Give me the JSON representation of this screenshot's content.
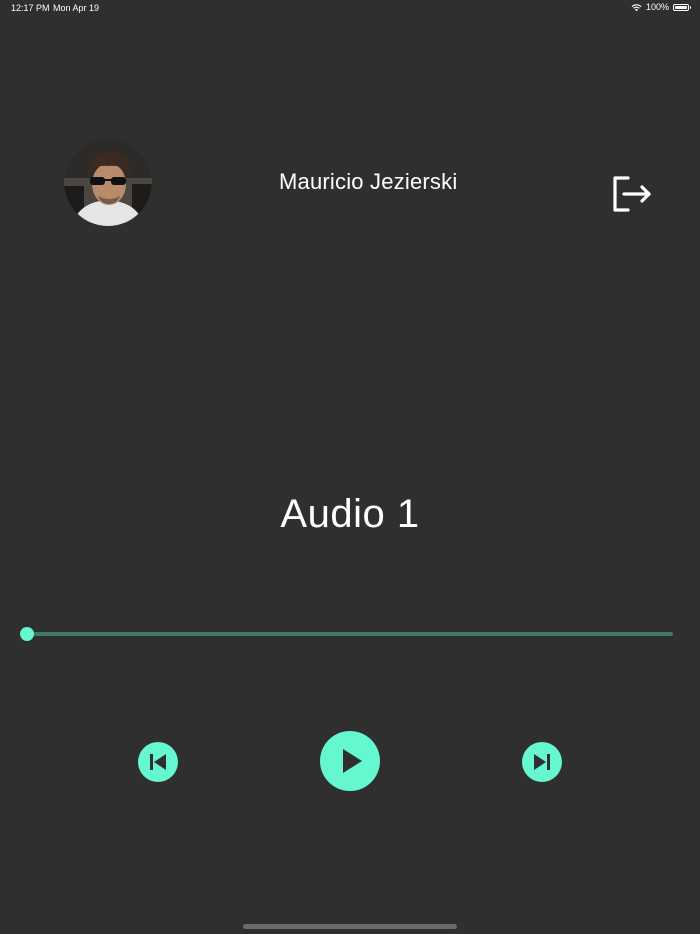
{
  "status_bar": {
    "time": "12:17 PM",
    "date": "Mon Apr 19",
    "battery": "100%",
    "icons": [
      "wifi-icon",
      "battery-icon"
    ]
  },
  "profile": {
    "name": "Mauricio Jezierski",
    "avatar": "user-avatar-photo"
  },
  "header": {
    "logout_icon": "logout-icon"
  },
  "player": {
    "track_title": "Audio 1",
    "progress": 0,
    "controls": [
      "skip-previous-icon",
      "play-icon",
      "skip-next-icon"
    ]
  },
  "colors": {
    "background": "#2f2f2f",
    "accent": "#64f7d0",
    "track": "#3f7a66",
    "text": "#ffffff"
  }
}
